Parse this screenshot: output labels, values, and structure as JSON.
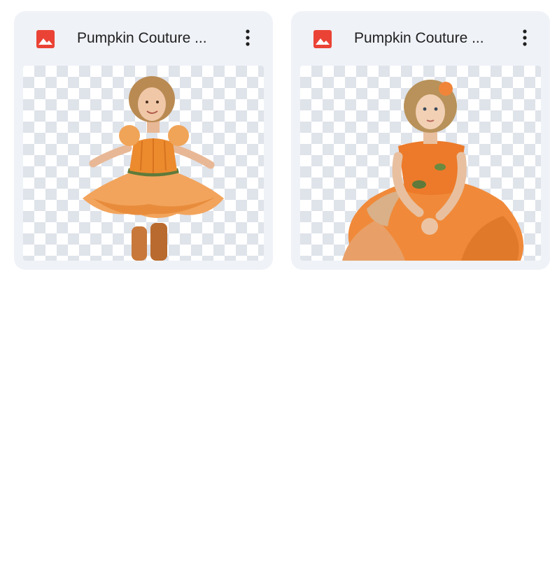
{
  "files": [
    {
      "name": "Pumpkin Couture ...",
      "icon": "image-file-icon",
      "icon_color": "#ea4335",
      "thumbnail": "girl in orange pumpkin tutu dress dancing"
    },
    {
      "name": "Pumpkin Couture ...",
      "icon": "image-file-icon",
      "icon_color": "#ea4335",
      "thumbnail": "girl in orange pumpkin gown sitting"
    }
  ],
  "more_icon": "more-vert-icon"
}
